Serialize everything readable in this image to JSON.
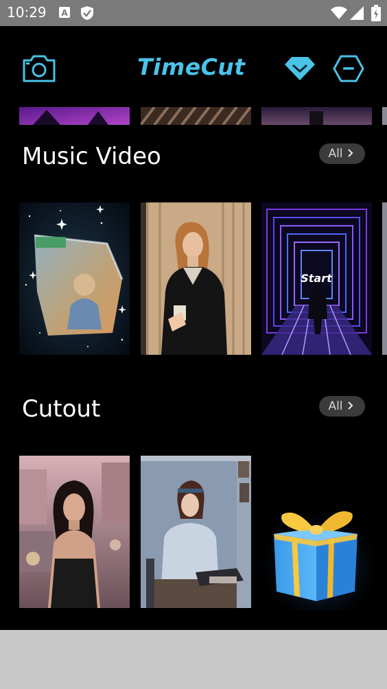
{
  "status_bar": {
    "time": "10:29",
    "icons": [
      "a-notification-icon",
      "shield-check-icon",
      "wifi-icon",
      "signal-icon",
      "battery-icon"
    ]
  },
  "app": {
    "logo_text": "TimeCut",
    "brand_color": "#49c3e8",
    "header_icons": [
      "camera-icon",
      "diamond-icon",
      "settings-hexagon-icon"
    ]
  },
  "sections": [
    {
      "title": "Music Video",
      "all_label": "All",
      "items": [
        "sparkle-photo-cube",
        "woman-black-coat",
        "neon-tunnel-start"
      ],
      "tunnel_overlay_text": "Start"
    },
    {
      "title": "Cutout",
      "all_label": "All",
      "items": [
        "woman-city-street",
        "woman-typewriter",
        "gift-box"
      ]
    }
  ]
}
